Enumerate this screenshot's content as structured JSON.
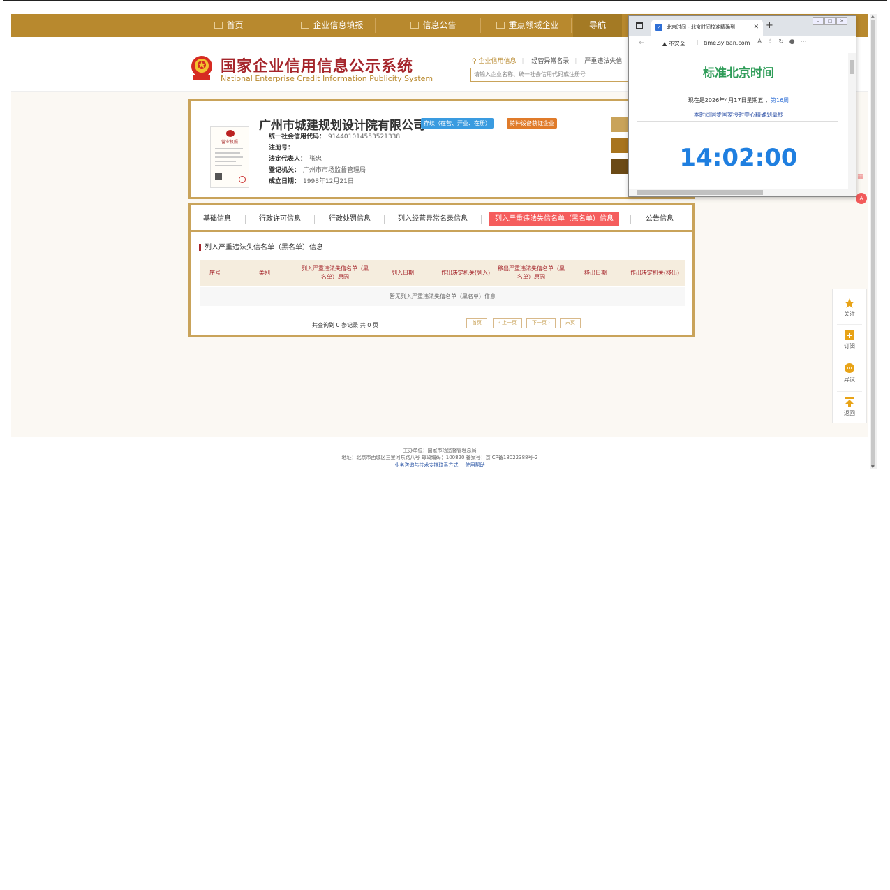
{
  "nav": {
    "items": [
      "首页",
      "企业信息填报",
      "信息公告",
      "重点领域企业",
      "导航"
    ]
  },
  "header": {
    "title": "国家企业信用信息公示系统",
    "subtitle": "National Enterprise Credit Information Publicity System",
    "search_tabs": [
      "企业信用信息",
      "经营异常名录",
      "严重违法失信"
    ],
    "search_placeholder": "请输入企业名称、统一社会信用代码或注册号"
  },
  "company": {
    "license_title": "营业执照",
    "name": "广州市城建规划设计院有限公司",
    "status": "存续（在营、开业、在册）",
    "special_badge": "特种设备获证企业",
    "credit_code_label": "统一社会信用代码：",
    "credit_code": "914401014553521338",
    "reg_no_label": "注册号：",
    "reg_no": "",
    "legal_rep_label": "法定代表人：",
    "legal_rep": "张忠",
    "reg_authority_label": "登记机关：",
    "reg_authority": "广州市市场监督管理局",
    "established_label": "成立日期：",
    "established": "1998年12月21日"
  },
  "tabs": [
    "基础信息",
    "行政许可信息",
    "行政处罚信息",
    "列入经营异常名录信息",
    "列入严重违法失信名单（黑名单）信息",
    "公告信息"
  ],
  "section": {
    "title": "列入严重违法失信名单（黑名单）信息",
    "columns": [
      "序号",
      "类别",
      "列入严重违法失信名单（黑名单）原因",
      "列入日期",
      "作出决定机关(列入)",
      "移出严重违法失信名单（黑名单）原因",
      "移出日期",
      "作出决定机关(移出)"
    ],
    "empty": "暂无列入严重违法失信名单（黑名单）信息",
    "pager_info": "共查询到 0 条记录 共 0 页",
    "pager": {
      "first": "首页",
      "prev": "‹ 上一页",
      "next": "下一页 ›",
      "last": "末页"
    }
  },
  "side_tools": [
    "关注",
    "订阅",
    "异议",
    "返回"
  ],
  "footer": {
    "line1": "主办单位：国家市场监督管理总局",
    "line2": "地址：北京市西城区三里河东路八号   邮政编码：100820   备案号：京ICP备18022388号-2",
    "links": [
      "业务咨询与技术支持联系方式",
      "使用帮助"
    ]
  },
  "popup": {
    "tab_title": "北京时间 - 北京时间校准精确到",
    "security": "不安全",
    "url": "time.syiban.com",
    "heading": "标准北京时间",
    "date_text": "现在是2026年4月17日星期五 ，",
    "week": "第16周",
    "sync_text": "本时间同步国家授时中心精确到毫秒",
    "time": "14:02:00"
  },
  "colors": {
    "nav_bg": "#b8892e",
    "brand_red": "#a5252b",
    "tab_active": "#f55d5d",
    "time_blue": "#1f7fe0",
    "title_green": "#2e9c58"
  }
}
